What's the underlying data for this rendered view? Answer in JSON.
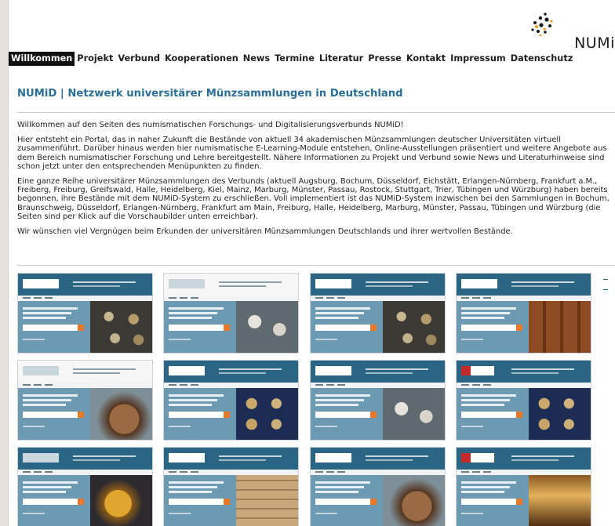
{
  "logo": {
    "text": "NUMiD"
  },
  "nav": {
    "items": [
      {
        "label": "Willkommen",
        "active": true
      },
      {
        "label": "Projekt"
      },
      {
        "label": "Verbund"
      },
      {
        "label": "Kooperationen"
      },
      {
        "label": "News"
      },
      {
        "label": "Termine"
      },
      {
        "label": "Literatur"
      },
      {
        "label": "Presse"
      },
      {
        "label": "Kontakt"
      },
      {
        "label": "Impressum"
      },
      {
        "label": "Datenschutz"
      }
    ]
  },
  "page": {
    "title": "NUMiD | Netzwerk universitärer Münzsammlungen in Deutschland",
    "paragraphs": [
      "Willkommen auf den Seiten des numismatischen Forschungs- und Digitalisierungsverbunds NUMiD!",
      "Hier entsteht ein Portal, das in naher Zukunft die Bestände von aktuell 34 akademischen Münzsammlungen deutscher Universitäten virtuell zusammenführt. Darüber hinaus werden hier numismatische E-Learning-Module entstehen, Online-Ausstellungen präsentiert und weitere Angebote aus dem Bereich numismatischer Forschung und Lehre bereitgestellt. Nähere Informationen zu Projekt und Verbund sowie News und Literaturhinweise sind schon jetzt unter den entsprechenden Menüpunkten zu finden.",
      "Eine ganze Reihe universitärer Münzsammlungen des Verbunds (aktuell Augsburg, Bochum, Düsseldorf, Eichstätt, Erlangen-Nürnberg, Frankfurt a.M., Freiberg, Freiburg, Greifswald, Halle, Heidelberg, Kiel, Mainz, Marburg, Münster, Passau, Rostock, Stuttgart, Trier, Tübingen und Würzburg) haben bereits begonnen, ihre Bestände mit dem NUMiD-System zu erschließen. Voll implementiert ist das NUMiD-System inzwischen bei den Sammlungen in Bochum, Braunschweig, Düsseldorf, Erlangen-Nürnberg, Frankfurt am Main, Freiburg, Halle, Heidelberg, Marburg, Münster, Passau, Tübingen und Würzburg (die Seiten sind per Klick auf die Vorschaubilder unten erreichbar).",
      "Wir wünschen viel Vergnügen beim Erkunden der universitären Münzsammlungen Deutschlands und ihrer wertvollen Bestände."
    ]
  },
  "thumbnails": [
    {
      "name": "thumb-bochum",
      "head": "dark",
      "logo": "light",
      "img": "coins"
    },
    {
      "name": "thumb-braunschweig",
      "head": "light",
      "logo": "dark",
      "img": "white-coins"
    },
    {
      "name": "thumb-duesseldorf",
      "head": "dark",
      "logo": "light",
      "img": "coins"
    },
    {
      "name": "thumb-erlangen",
      "head": "dark",
      "logo": "light",
      "img": "drawer"
    },
    {
      "name": "thumb-frankfurt",
      "head": "light",
      "logo": "dark",
      "img": "bronze"
    },
    {
      "name": "thumb-freiburg",
      "head": "dark",
      "logo": "light",
      "img": "tray-blue"
    },
    {
      "name": "thumb-halle",
      "head": "dark",
      "logo": "light",
      "img": "white-coins"
    },
    {
      "name": "thumb-heidelberg",
      "head": "dark",
      "logo": "red",
      "img": "tray-blue"
    },
    {
      "name": "thumb-marburg",
      "head": "dark",
      "logo": "dark",
      "img": "gold"
    },
    {
      "name": "thumb-muenster",
      "head": "dark",
      "logo": "light",
      "img": "cabinet"
    },
    {
      "name": "thumb-passau",
      "head": "dark",
      "logo": "light",
      "img": "bronze"
    },
    {
      "name": "thumb-tuebingen",
      "head": "dark",
      "logo": "red",
      "img": "altar"
    }
  ],
  "colors": {
    "title": "#2a6f98",
    "site_blue": "#2a6683",
    "hero_blue": "#6b9ab2",
    "accent_orange": "#e8782a"
  }
}
